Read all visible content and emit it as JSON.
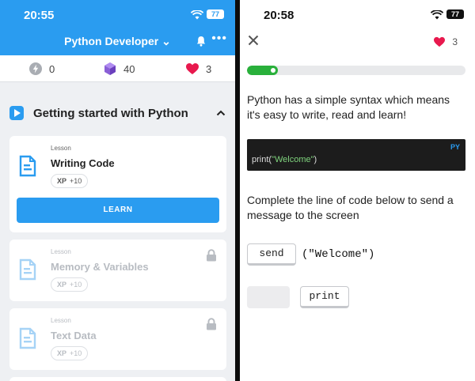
{
  "left": {
    "status": {
      "time": "20:55",
      "battery": "77"
    },
    "header": {
      "title": "Python Developer",
      "caret": "⌄",
      "more": "•••"
    },
    "stats": {
      "bolts": "0",
      "gems": "40",
      "hearts": "3"
    },
    "section": {
      "title": "Getting started with Python"
    },
    "lessons": [
      {
        "type": "Lesson",
        "title": "Writing Code",
        "xp_label": "XP",
        "xp_value": "+10",
        "button": "LEARN"
      },
      {
        "type": "Lesson",
        "title": "Memory & Variables",
        "xp_label": "XP",
        "xp_value": "+10"
      },
      {
        "type": "Lesson",
        "title": "Text Data",
        "xp_label": "XP",
        "xp_value": "+10"
      }
    ]
  },
  "right": {
    "status": {
      "time": "20:58",
      "battery": "77"
    },
    "lives": "3",
    "progress": 0.14,
    "intro": "Python has a simple syntax which means it's easy to write, read and learn!",
    "code": {
      "lang": "PY",
      "fn": "print",
      "open": "(",
      "str": "\"Welcome\"",
      "close": ")"
    },
    "instruction": "Complete the line of code below to send a message to the screen",
    "answer_chip": "send",
    "answer_rest": "(\"Welcome\")",
    "option_chip": "print"
  },
  "colors": {
    "accent": "#2a9cf0",
    "heart": "#e8194e",
    "success": "#29b03b",
    "gem": "#8a5fd6"
  }
}
